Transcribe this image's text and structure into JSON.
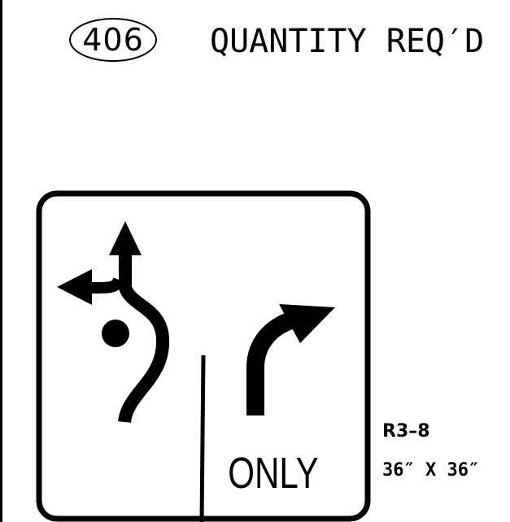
{
  "quantity": {
    "value": "406",
    "label": "QUANTITY REQ′D"
  },
  "sign": {
    "legend": "ONLY",
    "code": "R3–8",
    "size": "36″ X 36″",
    "icons": [
      "left-through-roundabout-arrow-icon",
      "right-turn-arrow-icon"
    ],
    "colors": {
      "legend": "#000000",
      "background": "#ffffff"
    }
  }
}
